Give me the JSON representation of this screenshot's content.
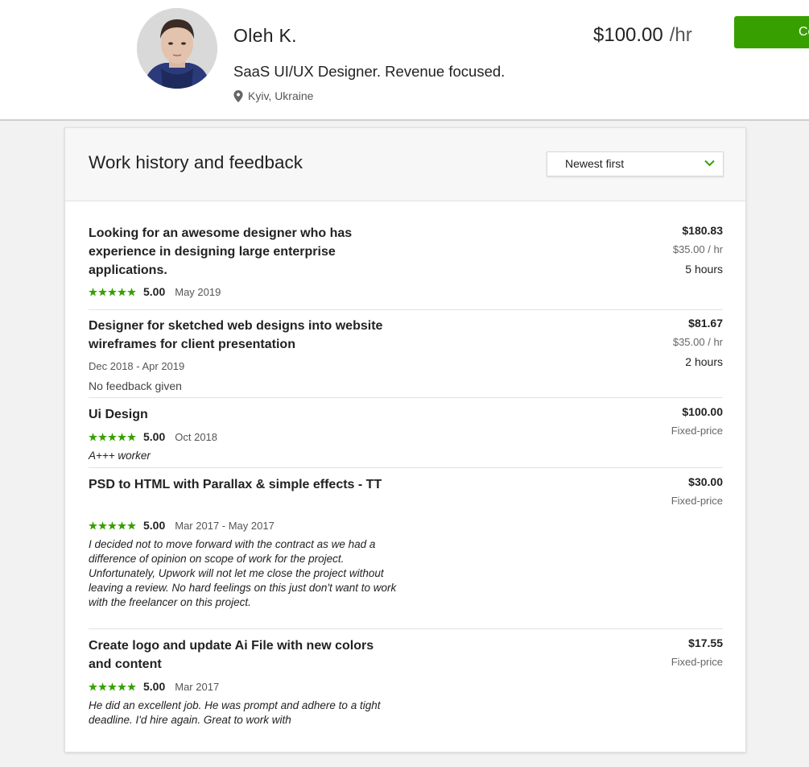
{
  "profile": {
    "name": "Oleh K.",
    "headline": "SaaS UI/UX Designer. Revenue focused.",
    "location": "Kyiv, Ukraine",
    "rate": "$100.00",
    "rate_unit": "/hr",
    "contact_label": "Co",
    "accent_color": "#37a000"
  },
  "work_history": {
    "title": "Work history and feedback",
    "sort_selected": "Newest first",
    "star_color": "#37a000",
    "jobs": [
      {
        "title": "Looking for an awesome designer who has experience in designing large enterprise applications.",
        "rating": "5.00",
        "date": "May 2019",
        "amount": "$180.83",
        "rate": "$35.00 / hr",
        "hours": "5 hours"
      },
      {
        "title": "Designer for sketched web designs into website wireframes for client presentation",
        "dates": "Dec 2018 - Apr 2019",
        "feedback": "No feedback given",
        "amount": "$81.67",
        "rate": "$35.00 / hr",
        "hours": "2 hours"
      },
      {
        "title": "Ui Design",
        "rating": "5.00",
        "date": "Oct 2018",
        "feedback": "A+++ worker",
        "amount": "$100.00",
        "price_type": "Fixed-price"
      },
      {
        "title": "PSD to HTML with Parallax & simple effects - TT",
        "rating": "5.00",
        "date": "Mar 2017 - May 2017",
        "feedback": "I decided not to move forward with the contract as we had a difference of opinion on scope of work for the project. Unfortunately, Upwork will not let me close the project without leaving a review. No hard feelings on this just don't want to work with the freelancer on this project.",
        "amount": "$30.00",
        "price_type": "Fixed-price"
      },
      {
        "title": "Create logo and update Ai File with new colors and content",
        "rating": "5.00",
        "date": "Mar 2017",
        "feedback": "He did an excellent job. He was prompt and adhere to a tight deadline. I'd hire again. Great to work with",
        "amount": "$17.55",
        "price_type": "Fixed-price"
      }
    ]
  }
}
